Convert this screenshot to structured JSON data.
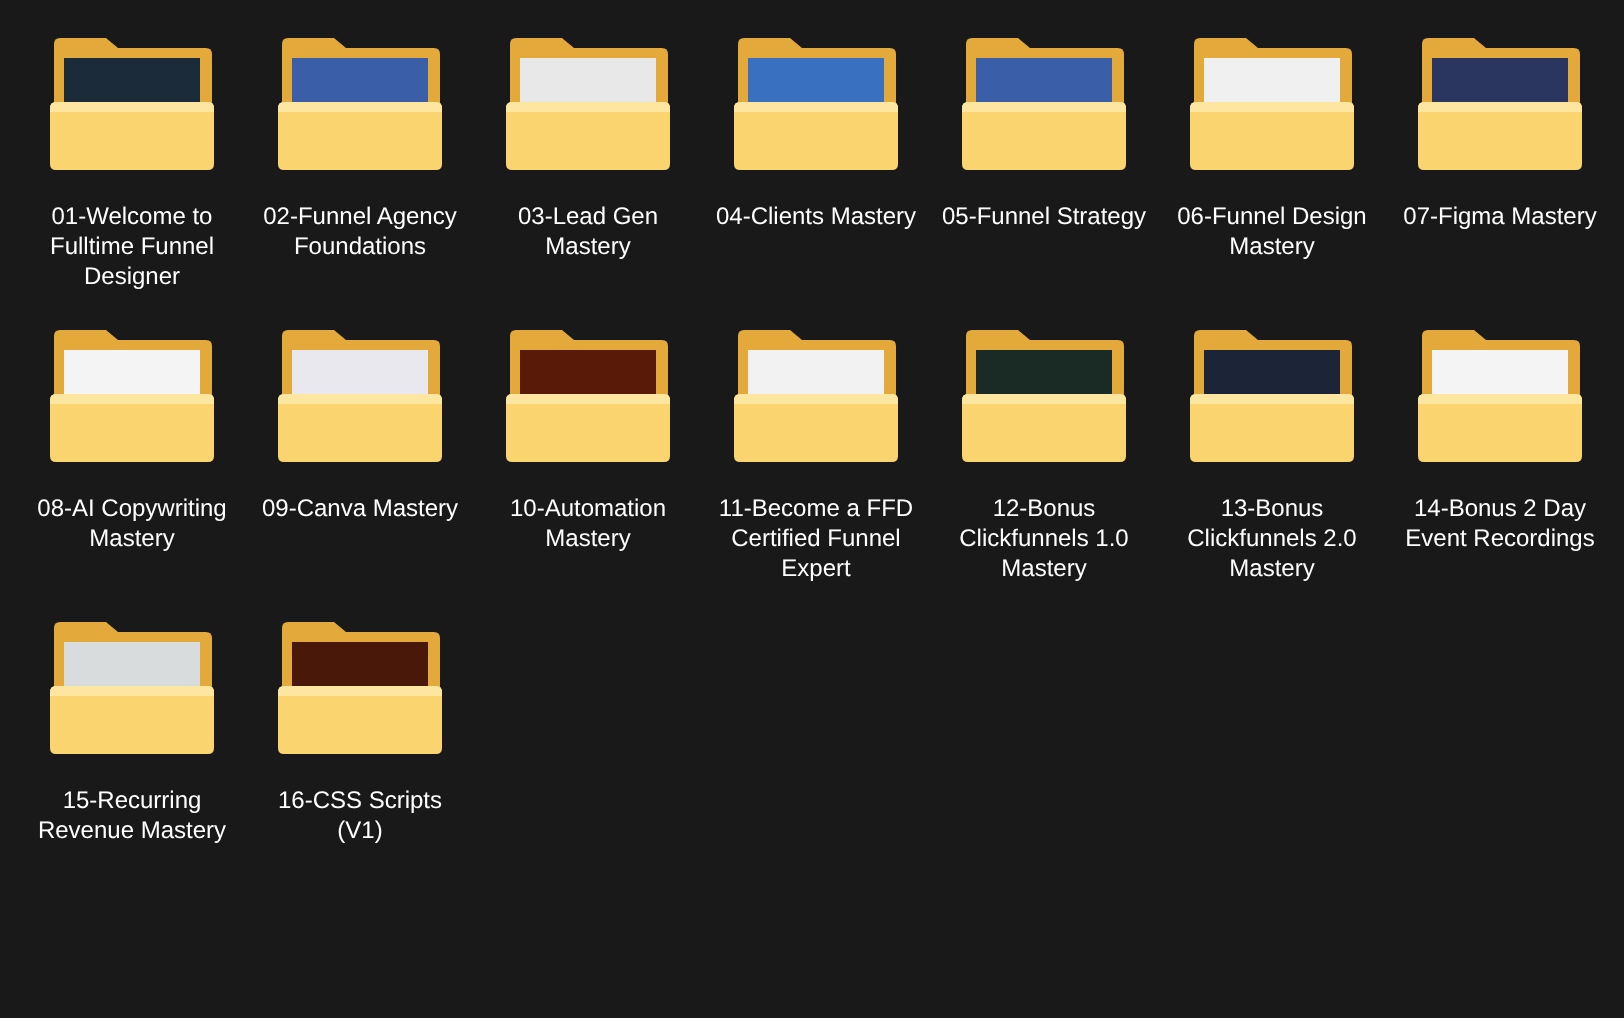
{
  "folders": [
    {
      "name": "01-Welcome to Fulltime Funnel Designer"
    },
    {
      "name": "02-Funnel Agency Foundations"
    },
    {
      "name": "03-Lead Gen Mastery"
    },
    {
      "name": "04-Clients Mastery"
    },
    {
      "name": "05-Funnel Strategy"
    },
    {
      "name": "06-Funnel Design Mastery"
    },
    {
      "name": "07-Figma Mastery"
    },
    {
      "name": "08-AI Copywriting Mastery"
    },
    {
      "name": "09-Canva Mastery"
    },
    {
      "name": "10-Automation Mastery"
    },
    {
      "name": "11-Become a FFD Certified Funnel Expert"
    },
    {
      "name": "12-Bonus Clickfunnels 1.0 Mastery"
    },
    {
      "name": "13-Bonus Clickfunnels 2.0 Mastery"
    },
    {
      "name": "14-Bonus 2 Day Event Recordings"
    },
    {
      "name": "15-Recurring Revenue Mastery"
    },
    {
      "name": "16-CSS Scripts (V1)"
    }
  ]
}
